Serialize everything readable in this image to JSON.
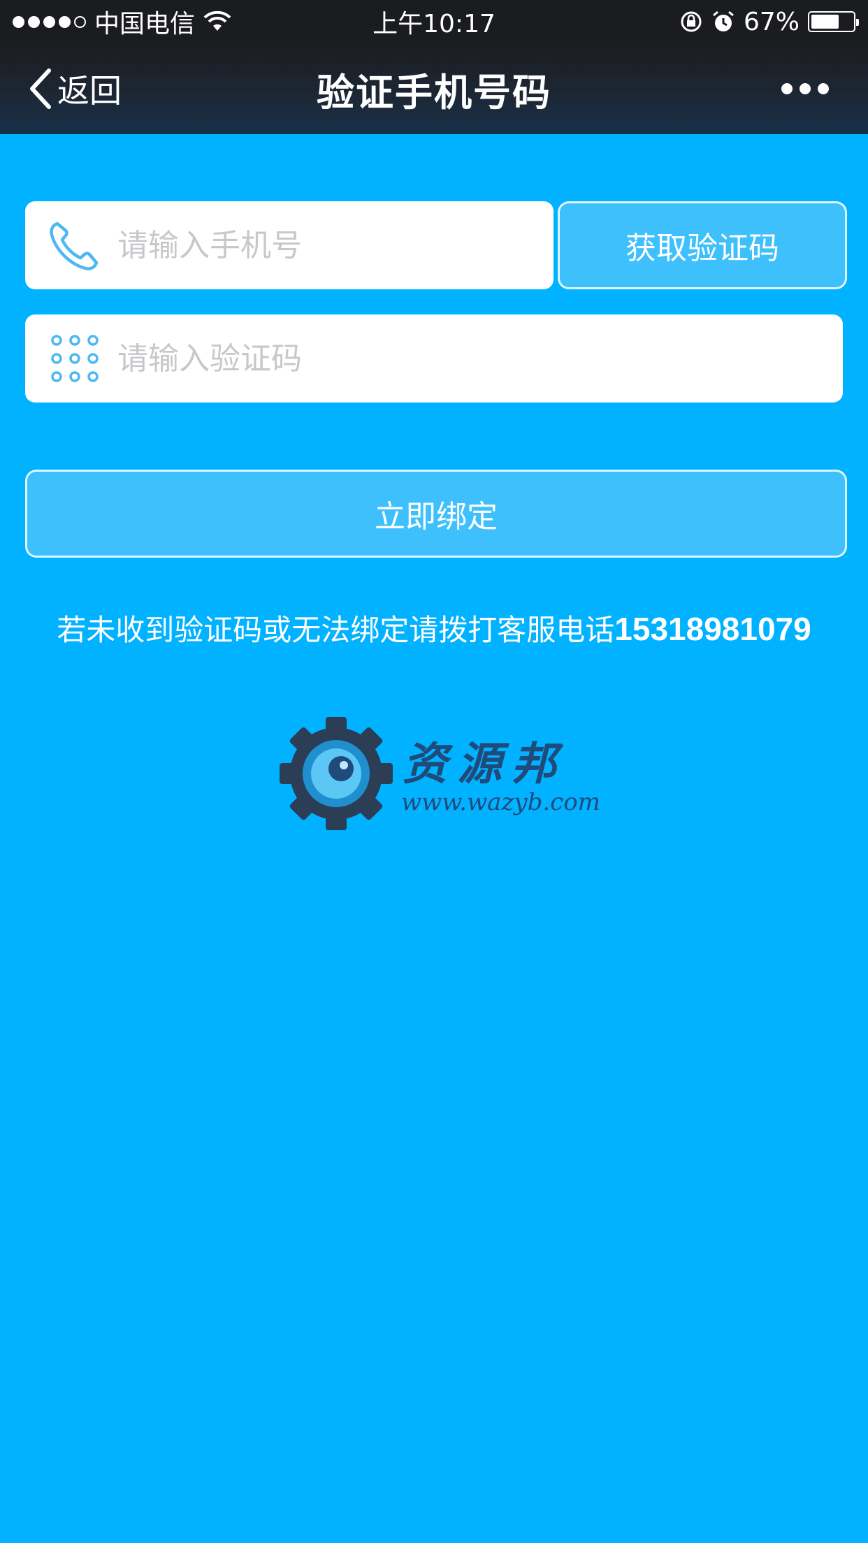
{
  "status_bar": {
    "carrier": "中国电信",
    "time": "上午10:17",
    "battery_percent": "67%",
    "battery_level": 0.67,
    "signal_bars": 4,
    "icons": [
      "signal-icon",
      "wifi-icon",
      "rotation-lock-icon",
      "alarm-icon",
      "battery-icon"
    ]
  },
  "nav": {
    "back_label": "返回",
    "title": "验证手机号码",
    "more_icon": "more-dots-icon"
  },
  "form": {
    "phone_placeholder": "请输入手机号",
    "phone_value": "",
    "get_code_label": "获取验证码",
    "code_placeholder": "请输入验证码",
    "code_value": "",
    "bind_label": "立即绑定"
  },
  "hint": {
    "text": "若未收到验证码或无法绑定请拨打客服电话",
    "phone": "15318981079"
  },
  "watermark": {
    "name": "资源邦",
    "url": "www.wazyb.com"
  },
  "colors": {
    "background": "#00b2ff",
    "status_bar": "#1b1c20",
    "button_fill": "#3dc0fb",
    "icon_blue": "#4fb8f2",
    "logo_dark": "#1f4a7a"
  }
}
